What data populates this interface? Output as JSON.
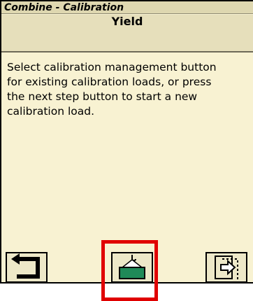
{
  "window": {
    "title": "Combine - Calibration"
  },
  "section": {
    "title": "Yield"
  },
  "instructions": {
    "line1": "Select calibration management button",
    "line2": "for existing calibration loads, or press",
    "line3": "the next step button to start a new",
    "line4": "calibration load."
  },
  "buttons": {
    "back_icon": "back-arrow-icon",
    "calibration_icon": "weight-hook-icon",
    "next_icon": "next-step-icon"
  },
  "colors": {
    "panel_bg": "#f8f2d2",
    "weight_fill": "#1f8a58",
    "highlight": "#e00000"
  }
}
